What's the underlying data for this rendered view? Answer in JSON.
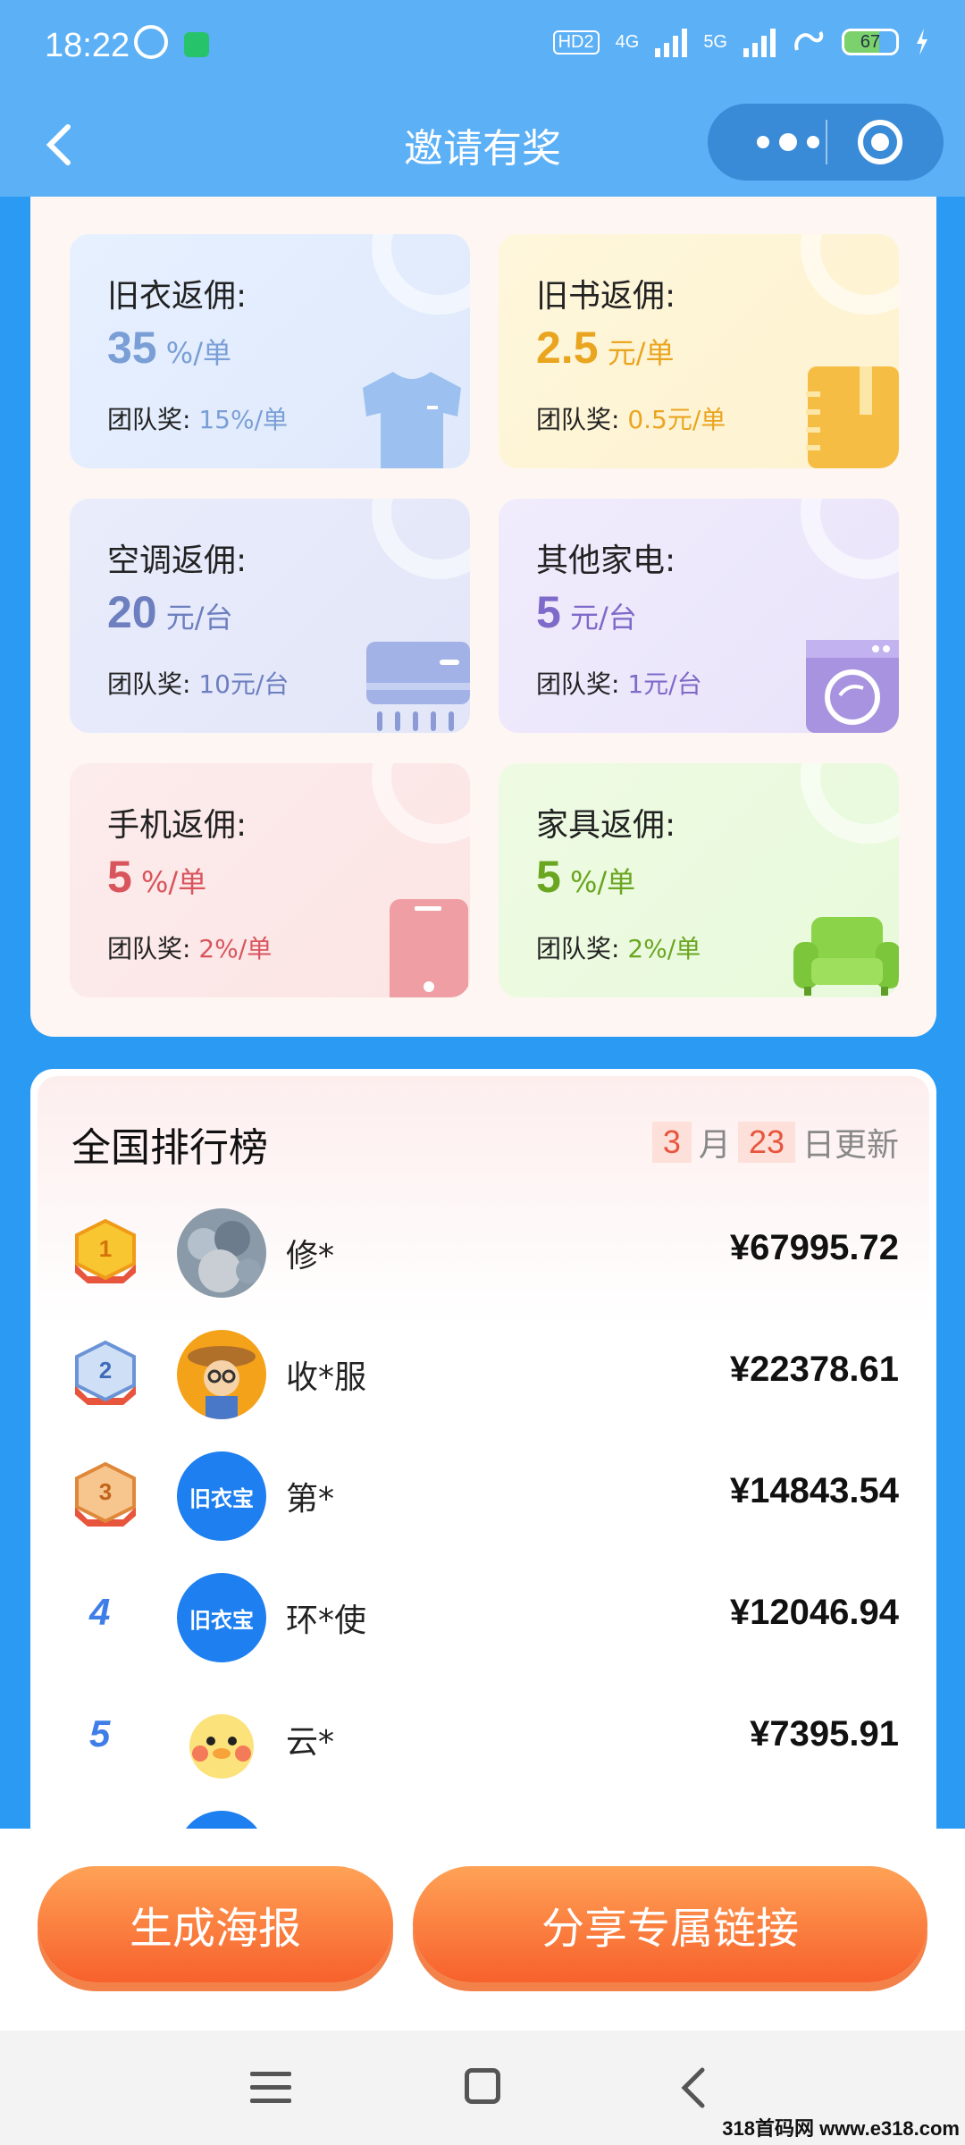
{
  "status_bar": {
    "time": "18:22",
    "network_labels": [
      "HD2",
      "4G",
      "5G"
    ],
    "battery": "67"
  },
  "header": {
    "title": "邀请有奖"
  },
  "commission": {
    "cards": [
      {
        "title": "旧衣返佣:",
        "rate_num": "35",
        "rate_unit": "%/单",
        "team_label": "团队奖:",
        "team_value": "15%/单",
        "icon": "tshirt-icon",
        "color": "#7a9fd6"
      },
      {
        "title": "旧书返佣:",
        "rate_num": "2.5",
        "rate_unit": "元/单",
        "team_label": "团队奖:",
        "team_value": "0.5元/单",
        "icon": "book-icon",
        "color": "#eaa520"
      },
      {
        "title": "空调返佣:",
        "rate_num": "20",
        "rate_unit": "元/台",
        "team_label": "团队奖:",
        "team_value": "10元/台",
        "icon": "air-conditioner-icon",
        "color": "#6e7fc0"
      },
      {
        "title": "其他家电:",
        "rate_num": "5",
        "rate_unit": "元/台",
        "team_label": "团队奖:",
        "team_value": "1元/台",
        "icon": "washing-machine-icon",
        "color": "#7d6ac9"
      },
      {
        "title": "手机返佣:",
        "rate_num": "5",
        "rate_unit": "%/单",
        "team_label": "团队奖:",
        "team_value": "2%/单",
        "icon": "phone-icon",
        "color": "#d9555d"
      },
      {
        "title": "家具返佣:",
        "rate_num": "5",
        "rate_unit": "%/单",
        "team_label": "团队奖:",
        "team_value": "2%/单",
        "icon": "sofa-icon",
        "color": "#6aa620"
      }
    ]
  },
  "ranking": {
    "title": "全国排行榜",
    "update_month": "3",
    "month_label": "月",
    "update_day": "23",
    "day_label": "日更新",
    "rows": [
      {
        "rank": "1",
        "name": "修*",
        "amount": "¥67995.72",
        "avatar": "clothes-pile-avatar"
      },
      {
        "rank": "2",
        "name": "收*服",
        "amount": "¥22378.61",
        "avatar": "farmer-cartoon-avatar"
      },
      {
        "rank": "3",
        "name": "第*",
        "amount": "¥14843.54",
        "avatar": "jiuyibao-logo-avatar",
        "avatar_text": "旧衣宝"
      },
      {
        "rank": "4",
        "name": "环*使",
        "amount": "¥12046.94",
        "avatar": "jiuyibao-logo-avatar",
        "avatar_text": "旧衣宝"
      },
      {
        "rank": "5",
        "name": "云*",
        "amount": "¥7395.91",
        "avatar": "duck-cartoon-avatar"
      }
    ]
  },
  "actions": {
    "poster_label": "生成海报",
    "share_label": "分享专属链接"
  },
  "watermark": "318首码网 www.e318.com"
}
